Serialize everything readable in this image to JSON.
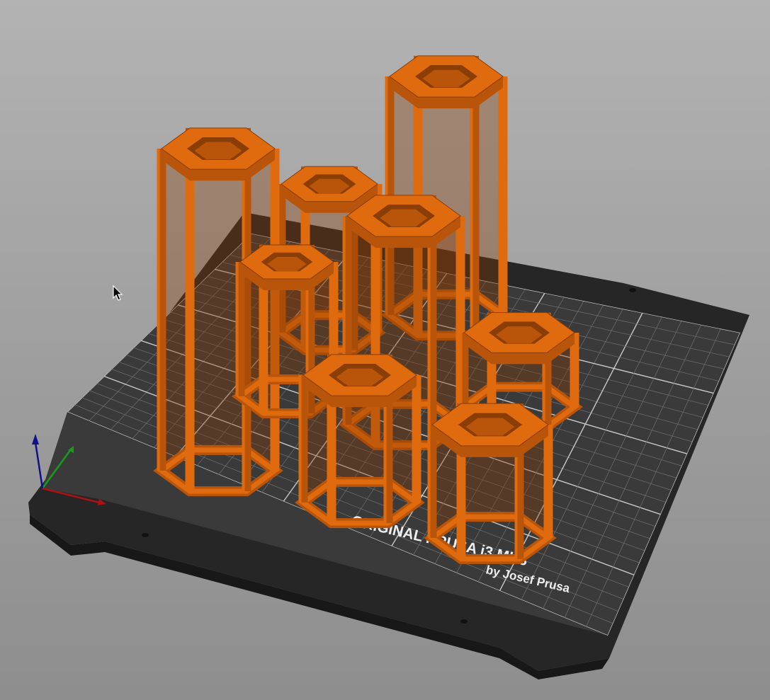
{
  "bed": {
    "brand_line1": "ORIGINAL PRUSA i3 MK3",
    "brand_line2": "by Josef Prusa",
    "surface_color": "#3a3a3a",
    "frame_color": "#262626",
    "grid_color": "#8a8a8a"
  },
  "model": {
    "color": "#e06b0e",
    "shade_color": "#b8550a",
    "dark_color": "#8a3d05",
    "part_count": 9
  },
  "axes": {
    "x_color": "#b01010",
    "y_color": "#1a9a1a",
    "z_color": "#10108a"
  },
  "cursor": {
    "type": "arrow-pointer"
  }
}
